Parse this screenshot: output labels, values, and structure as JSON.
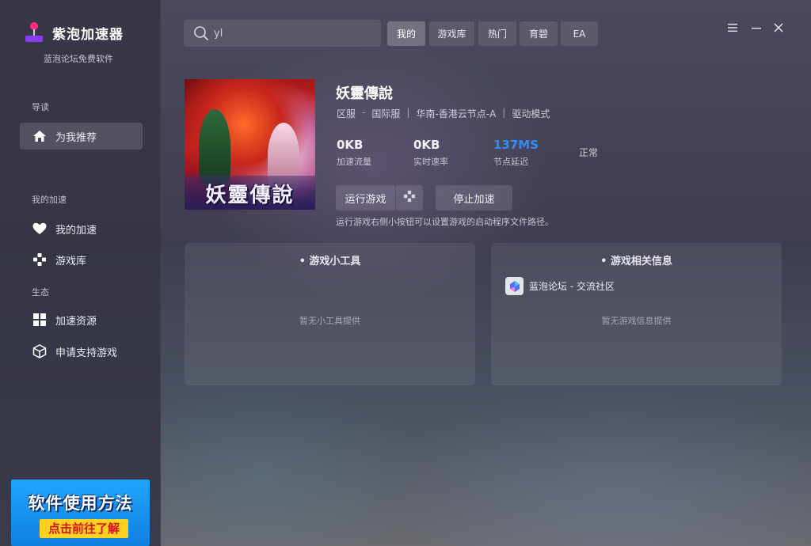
{
  "app": {
    "name": "紫泡加速器",
    "subtitle": "蓝泡论坛免费软件"
  },
  "sidebar": {
    "sections": [
      "导读",
      "我的加速",
      "生态"
    ],
    "items": [
      {
        "label": "为我推荐",
        "icon": "home-icon",
        "active": true
      },
      {
        "label": "我的加速",
        "icon": "heart-icon"
      },
      {
        "label": "游戏库",
        "icon": "gamepad-icon"
      },
      {
        "label": "加速资源",
        "icon": "grid-icon"
      },
      {
        "label": "申请支持游戏",
        "icon": "cube-icon"
      }
    ],
    "promo": {
      "line1": "软件使用方法",
      "line2": "点击前往了解"
    }
  },
  "search": {
    "value": "yl",
    "icon": "search-icon"
  },
  "tabs": [
    {
      "label": "我的",
      "active": true
    },
    {
      "label": "游戏库"
    },
    {
      "label": "热门"
    },
    {
      "label": "育碧"
    },
    {
      "label": "EA"
    }
  ],
  "window_controls": [
    "menu-icon",
    "minimize-icon",
    "close-icon"
  ],
  "game": {
    "title": "妖靈傳說",
    "cover_title": "妖靈傳說",
    "meta": [
      "区服",
      "-",
      "国际服",
      "|",
      "华南-香港云节点-A",
      "|",
      "驱动模式"
    ],
    "stats": [
      {
        "value": "0KB",
        "label": "加速流量"
      },
      {
        "value": "0KB",
        "label": "实时速率"
      },
      {
        "value": "137MS",
        "label": "节点延迟"
      }
    ],
    "status": "正常",
    "run_label": "运行游戏",
    "stop_label": "停止加速",
    "hint": "运行游戏右侧小按钮可以设置游戏的启动程序文件路径。"
  },
  "panels": {
    "tools": {
      "title": "• 游戏小工具",
      "empty": "暂无小工具提供"
    },
    "info": {
      "title": "• 游戏相关信息",
      "link": "蓝泡论坛 - 交流社区",
      "empty": "暂无游戏信息提供"
    }
  },
  "colors": {
    "accent_blue": "#2f8fff",
    "logo_pink": "#ff2d7a",
    "logo_purple": "#8a3cff",
    "promo_blue": "#1fa6ff",
    "promo_yellow": "#ffd21f"
  }
}
